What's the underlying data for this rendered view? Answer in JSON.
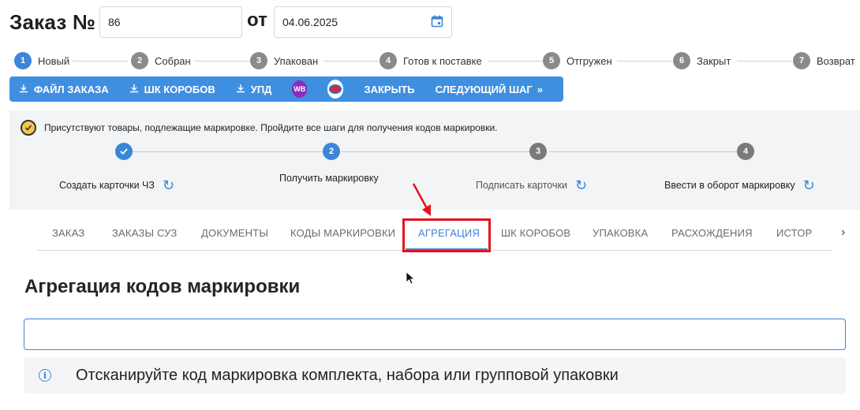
{
  "header": {
    "title": "Заказ №",
    "order_number": "86",
    "from_label": "от",
    "date": "04.06.2025"
  },
  "order_steps": [
    {
      "num": "1",
      "label": "Новый",
      "active": true
    },
    {
      "num": "2",
      "label": "Собран"
    },
    {
      "num": "3",
      "label": "Упакован"
    },
    {
      "num": "4",
      "label": "Готов к поставке"
    },
    {
      "num": "5",
      "label": "Отгружен"
    },
    {
      "num": "6",
      "label": "Закрыт"
    },
    {
      "num": "7",
      "label": "Возврат"
    }
  ],
  "toolbar": {
    "order_file": "ФАЙЛ ЗАКАЗА",
    "box_barcodes": "ШК КОРОБОВ",
    "upd": "УПД",
    "wb_badge": "WB",
    "close": "ЗАКРЫТЬ",
    "next_step": "СЛЕДУЮЩИЙ ШАГ"
  },
  "marking": {
    "notice": "Присутствуют товары, подлежащие маркировке. Пройдите все шаги для получения кодов маркировки.",
    "steps": [
      {
        "num": "",
        "label": "Создать карточки ЧЗ",
        "state": "done"
      },
      {
        "num": "2",
        "label": "Получить маркировку",
        "state": "active"
      },
      {
        "num": "3",
        "label": "Подписать карточки",
        "state": "pending"
      },
      {
        "num": "4",
        "label": "Ввести в оборот маркировку",
        "state": "pending"
      }
    ]
  },
  "tabs": [
    {
      "label": "ЗАКАЗ"
    },
    {
      "label": "ЗАКАЗЫ СУЗ"
    },
    {
      "label": "ДОКУМЕНТЫ"
    },
    {
      "label": "КОДЫ МАРКИРОВКИ"
    },
    {
      "label": "АГРЕГАЦИЯ",
      "active": true
    },
    {
      "label": "ШК КОРОБОВ"
    },
    {
      "label": "УПАКОВКА"
    },
    {
      "label": "РАСХОЖДЕНИЯ"
    },
    {
      "label": "ИСТОРИЯ И"
    }
  ],
  "main": {
    "heading": "Агрегация кодов маркировки",
    "scan_value": "",
    "info_text": "Отсканируйте код маркировка комплекта, набора или групповой упаковки"
  },
  "colors": {
    "accent": "#3f8fe0",
    "highlight": "#e1141b"
  }
}
